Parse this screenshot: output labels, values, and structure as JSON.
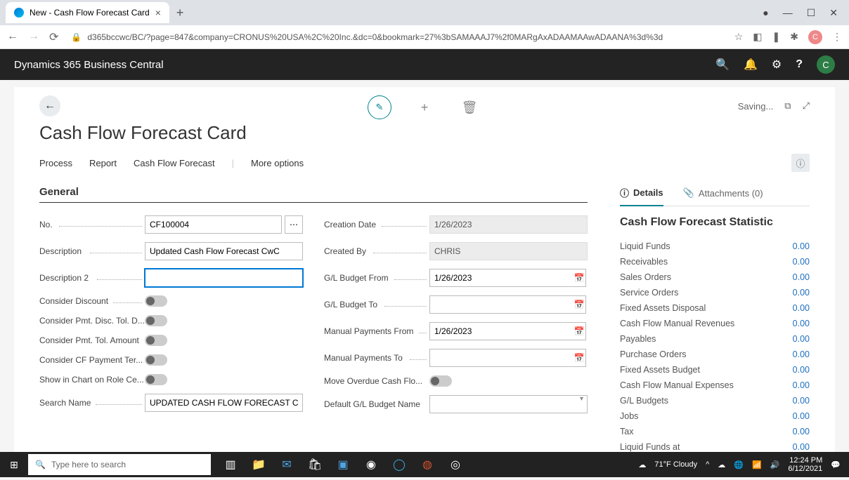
{
  "browser": {
    "tab_title": "New - Cash Flow Forecast Card",
    "url": "d365bccwc/BC/?page=847&company=CRONUS%20USA%2C%20Inc.&dc=0&bookmark=27%3bSAMAAAJ7%2f0MARgAxADAAMAAwADAANA%3d%3d"
  },
  "header": {
    "app_name": "Dynamics 365 Business Central",
    "avatar": "C"
  },
  "page": {
    "title": "Cash Flow Forecast Card",
    "status": "Saving...",
    "menu": {
      "process": "Process",
      "report": "Report",
      "cff": "Cash Flow Forecast",
      "more": "More options"
    },
    "section_general": "General"
  },
  "fields_left": {
    "no_label": "No.",
    "no_value": "CF100004",
    "description_label": "Description",
    "description_value": "Updated Cash Flow Forecast CwC",
    "description2_label": "Description 2",
    "description2_value": "",
    "consider_discount_label": "Consider Discount",
    "consider_pmt_disc_label": "Consider Pmt. Disc. Tol. D...",
    "consider_pmt_tol_label": "Consider Pmt. Tol. Amount",
    "consider_cf_label": "Consider CF Payment Ter...",
    "show_chart_label": "Show in Chart on Role Ce...",
    "search_name_label": "Search Name",
    "search_name_value": "UPDATED CASH FLOW FORECAST CWC"
  },
  "fields_right": {
    "creation_date_label": "Creation Date",
    "creation_date_value": "1/26/2023",
    "created_by_label": "Created By",
    "created_by_value": "CHRIS",
    "gl_from_label": "G/L Budget From",
    "gl_from_value": "1/26/2023",
    "gl_to_label": "G/L Budget To",
    "gl_to_value": "",
    "manual_from_label": "Manual Payments From",
    "manual_from_value": "1/26/2023",
    "manual_to_label": "Manual Payments To",
    "manual_to_value": "",
    "move_overdue_label": "Move Overdue Cash Flo...",
    "default_budget_label": "Default G/L Budget Name",
    "default_budget_value": ""
  },
  "sidebar": {
    "details_tab": "Details",
    "attachments_tab": "Attachments (0)",
    "title": "Cash Flow Forecast Statistic",
    "stats": [
      {
        "label": "Liquid Funds",
        "value": "0.00"
      },
      {
        "label": "Receivables",
        "value": "0.00"
      },
      {
        "label": "Sales Orders",
        "value": "0.00"
      },
      {
        "label": "Service Orders",
        "value": "0.00"
      },
      {
        "label": "Fixed Assets Disposal",
        "value": "0.00"
      },
      {
        "label": "Cash Flow Manual Revenues",
        "value": "0.00"
      },
      {
        "label": "Payables",
        "value": "0.00"
      },
      {
        "label": "Purchase Orders",
        "value": "0.00"
      },
      {
        "label": "Fixed Assets Budget",
        "value": "0.00"
      },
      {
        "label": "Cash Flow Manual Expenses",
        "value": "0.00"
      },
      {
        "label": "G/L Budgets",
        "value": "0.00"
      },
      {
        "label": "Jobs",
        "value": "0.00"
      },
      {
        "label": "Tax",
        "value": "0.00"
      },
      {
        "label": "Liquid Funds at",
        "value": "0.00"
      }
    ]
  },
  "taskbar": {
    "search_placeholder": "Type here to search",
    "weather": "71°F Cloudy",
    "time": "12:24 PM",
    "date": "6/12/2021"
  }
}
